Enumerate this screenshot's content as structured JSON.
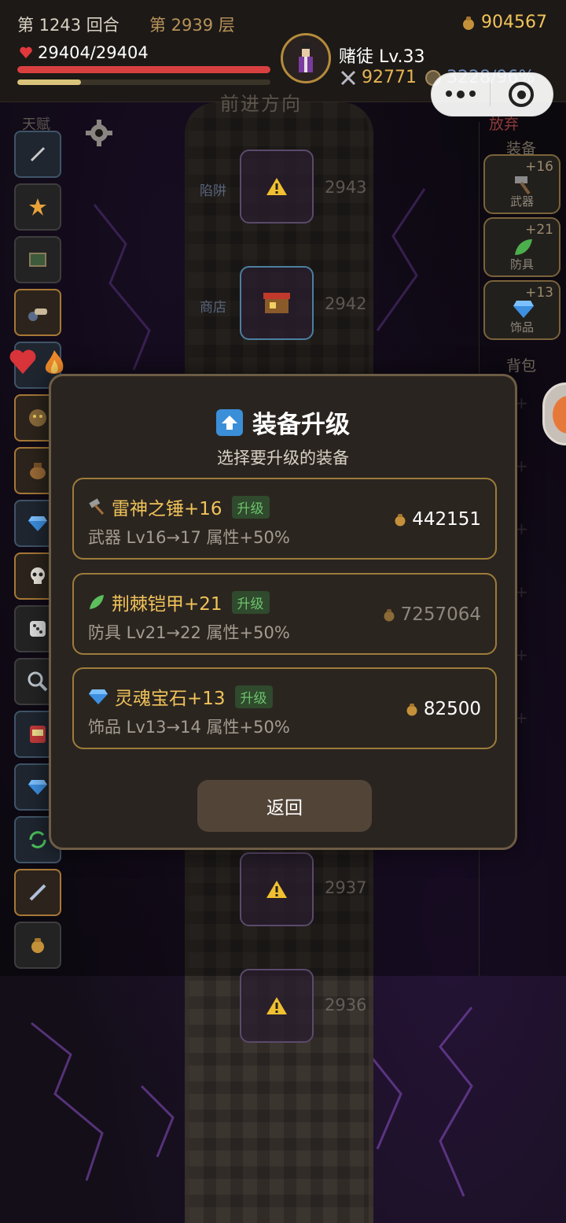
{
  "header": {
    "round": "第 1243 回合",
    "floor": "第 2939 层",
    "gold": "904567",
    "hp": "29404/29404",
    "hp_ratio": 1.0,
    "xp_ratio": 0.25,
    "player_name": "赌徒 Lv.33",
    "attack": "92771",
    "defense": "3228/96%"
  },
  "left_panel": {
    "title": "天赋",
    "slots": [
      "dagger-icon",
      "burst-icon",
      "painting-icon",
      "cannon-icon",
      "blank-icon",
      "golem-icon",
      "bag-icon",
      "diamond-icon",
      "skull-icon",
      "dice-icon",
      "magnifier-icon",
      "slot-machine-icon",
      "diamond-icon",
      "refresh-icon",
      "staff-icon",
      "money-bag-icon"
    ]
  },
  "map": {
    "direction": "前进方向",
    "nodes": [
      {
        "label": "陷阱",
        "floor": "2943",
        "icon": "warning-icon"
      },
      {
        "label": "商店",
        "floor": "2942",
        "icon": "shop-icon"
      },
      {
        "label": "",
        "floor": "2937",
        "icon": "warning-icon"
      },
      {
        "label": "",
        "floor": "2936",
        "icon": "warning-icon"
      }
    ]
  },
  "right_panel": {
    "abandon": "放弃",
    "equip_title": "装备",
    "equip": [
      {
        "level": "+16",
        "name": "武器",
        "icon": "hammer-icon"
      },
      {
        "level": "+21",
        "name": "防具",
        "icon": "leaf-icon"
      },
      {
        "level": "+13",
        "name": "饰品",
        "icon": "diamond-icon"
      }
    ],
    "bag_title": "背包"
  },
  "modal": {
    "title": "装备升级",
    "subtitle": "选择要升级的装备",
    "items": [
      {
        "name": "雷神之锤+16",
        "tag": "升级",
        "desc": "武器 Lv16→17 属性+50%",
        "price": "442151",
        "icon": "hammer-icon",
        "affordable": true
      },
      {
        "name": "荆棘铠甲+21",
        "tag": "升级",
        "desc": "防具 Lv21→22 属性+50%",
        "price": "7257064",
        "icon": "leaf-icon",
        "affordable": false
      },
      {
        "name": "灵魂宝石+13",
        "tag": "升级",
        "desc": "饰品 Lv13→14 属性+50%",
        "price": "82500",
        "icon": "diamond-icon",
        "affordable": true
      }
    ],
    "back": "返回"
  },
  "colors": {
    "gold": "#f0c35a",
    "hp": "#d8403f",
    "upgrade_tag": "#6ec26e",
    "item_border": "#9c7c3a"
  }
}
